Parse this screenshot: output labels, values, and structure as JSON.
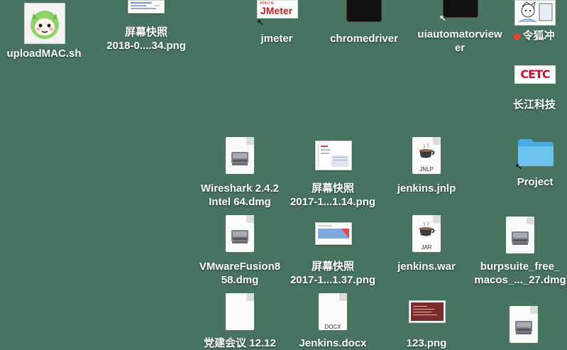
{
  "desktop": {
    "background": "#47735f",
    "items": [
      {
        "id": "upload",
        "label": "uploadMAC.sh",
        "icon": "shell-script-icon"
      },
      {
        "id": "shot1",
        "label_l1": "屏幕快照",
        "label_l2": "2018-0....34.png",
        "icon": "screenshot-thumbnail-icon"
      },
      {
        "id": "jmeter",
        "label": "jmeter",
        "icon_text": "JMeter",
        "icon_small": "APACHE",
        "icon": "jmeter-alias-icon"
      },
      {
        "id": "chromedriver",
        "label": "chromedriver",
        "icon": "terminal-executable-icon"
      },
      {
        "id": "uiautomator",
        "label_l1": "uiautomatorview",
        "label_l2": "er",
        "icon": "terminal-alias-icon"
      },
      {
        "id": "linghuchong",
        "label": "令狐冲",
        "icon": "manga-image-icon",
        "tag_color": "#ff3b30"
      },
      {
        "id": "cetc",
        "label": "长江科技",
        "icon_text": "CETC",
        "icon": "cetc-logo-icon"
      },
      {
        "id": "project",
        "label": "Project",
        "icon": "folder-alias-icon"
      },
      {
        "id": "wireshark",
        "label_l1": "Wireshark 2.4.2",
        "label_l2": "Intel 64.dmg",
        "icon": "disk-image-icon"
      },
      {
        "id": "shot2",
        "label_l1": "屏幕快照",
        "label_l2": "2017-1...1.14.png",
        "icon": "screenshot-thumbnail-icon"
      },
      {
        "id": "jnlp",
        "label": "jenkins.jnlp",
        "badge": "JNLP",
        "icon": "java-file-icon"
      },
      {
        "id": "vmware",
        "label_l1": "VMwareFusion8",
        "label_l2": "58.dmg",
        "icon": "disk-image-icon"
      },
      {
        "id": "shot3",
        "label_l1": "屏幕快照",
        "label_l2": "2017-1...1.37.png",
        "icon": "screenshot-thumbnail-icon"
      },
      {
        "id": "war",
        "label": "jenkins.war",
        "badge": "JAR",
        "icon": "java-file-icon"
      },
      {
        "id": "burp",
        "label_l1": "burpsuite_free_",
        "label_l2": "macos_..._27.dmg",
        "icon": "disk-image-icon"
      },
      {
        "id": "meeting",
        "label": "党建会议 12.12",
        "icon": "blank-document-icon"
      },
      {
        "id": "jenkinsdocx",
        "label": "Jenkins.docx",
        "badge": "DOCX",
        "icon": "word-document-icon"
      },
      {
        "id": "png123",
        "label": "123.png",
        "icon": "image-thumbnail-icon"
      },
      {
        "id": "dmg4",
        "icon": "disk-image-icon"
      }
    ]
  }
}
